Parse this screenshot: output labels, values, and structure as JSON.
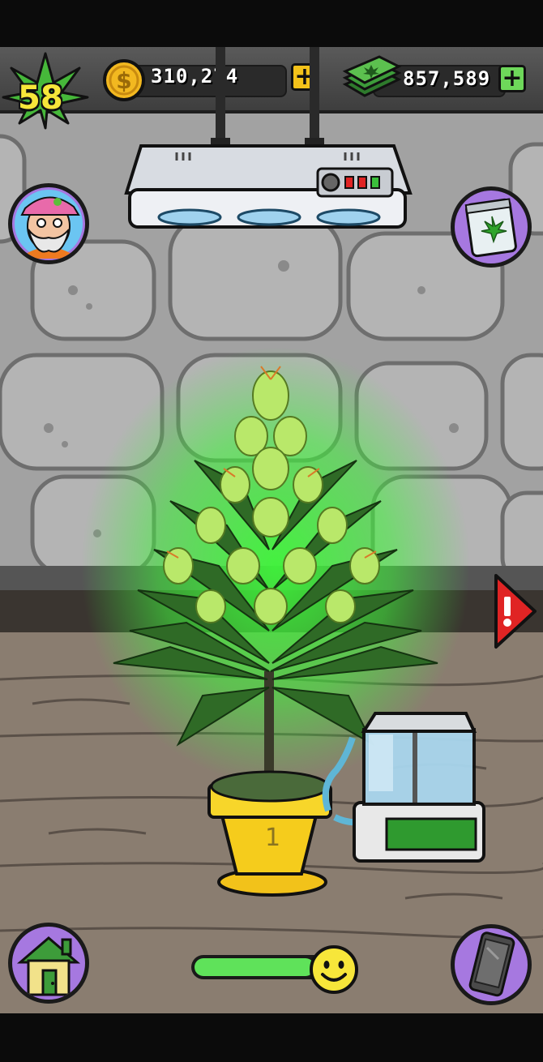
{
  "player": {
    "level": "58",
    "coins": "310,274",
    "cash": "857,589"
  },
  "hud": {
    "coin_icon": "coin-dollar-icon",
    "cash_icon": "cash-stack-icon",
    "level_icon": "leaf-badge-icon",
    "add_coins": "+",
    "add_cash": "+"
  },
  "plant": {
    "pot_number": "1"
  },
  "growth": {
    "progress": 0.88,
    "mood_icon": "smiley-icon"
  },
  "colors": {
    "accent_green": "#5fe25a",
    "coin_gold": "#f2b820",
    "cash_green": "#3d9c3a",
    "plus_yellow": "#f4c21a",
    "plus_green": "#6ed85a",
    "button_purple": "#a678e0",
    "alert_red": "#e02424",
    "plant_glow": "#3ff53a"
  }
}
